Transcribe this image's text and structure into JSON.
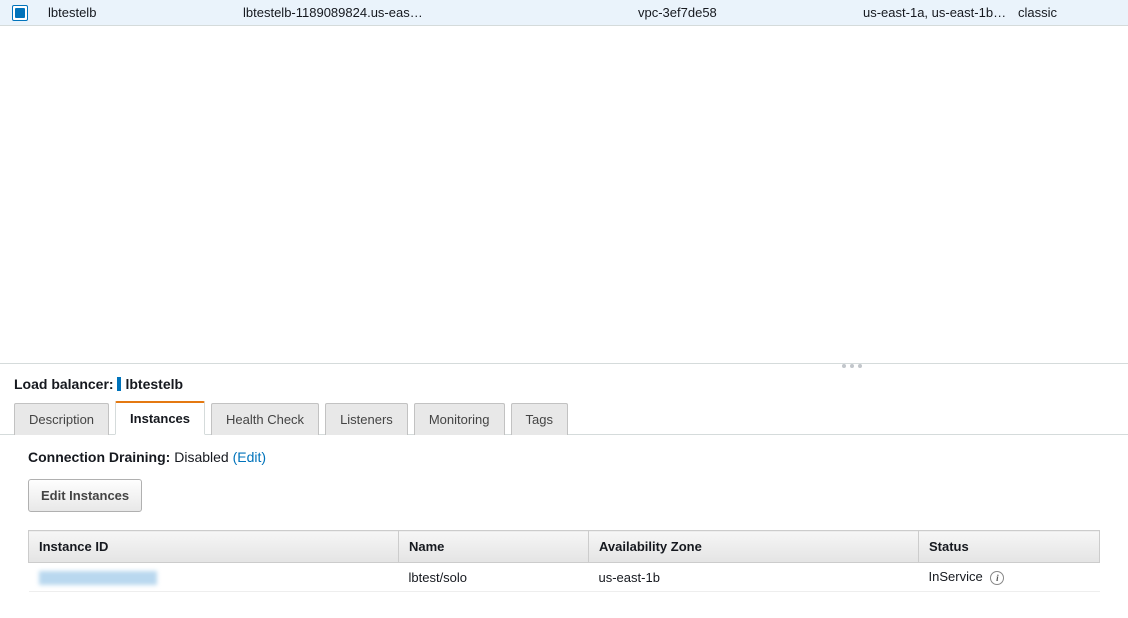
{
  "list": {
    "rows": [
      {
        "name": "lbtestelb",
        "dns": "lbtestelb-1189089824.us-eas…",
        "vpc": "vpc-3ef7de58",
        "az": "us-east-1a, us-east-1b, …",
        "type": "classic"
      }
    ]
  },
  "detail": {
    "heading_prefix": "Load balancer:",
    "heading_name": "lbtestelb",
    "tabs": {
      "description": "Description",
      "instances": "Instances",
      "health_check": "Health Check",
      "listeners": "Listeners",
      "monitoring": "Monitoring",
      "tags": "Tags"
    },
    "connection_draining": {
      "label": "Connection Draining:",
      "value": "Disabled",
      "edit": "(Edit)"
    },
    "edit_instances_button": "Edit Instances",
    "table": {
      "headers": {
        "instance_id": "Instance ID",
        "name": "Name",
        "az": "Availability Zone",
        "status": "Status"
      },
      "rows": [
        {
          "instance_id_hidden": true,
          "name": "lbtest/solo",
          "az": "us-east-1b",
          "status": "InService"
        }
      ]
    }
  }
}
